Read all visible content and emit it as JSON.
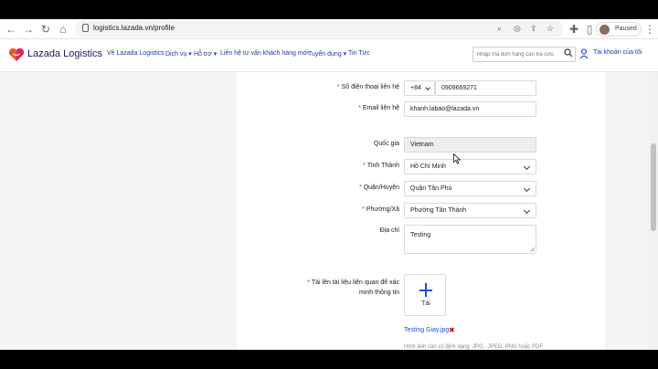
{
  "browser": {
    "url": "logistics.lazada.vn/profile",
    "profile_label": "Paused"
  },
  "header": {
    "logo_text": "Lazada Logistics",
    "menu": [
      {
        "label": "Về Lazada Logistics"
      },
      {
        "label": "Dịch vụ ▾"
      },
      {
        "label": "Hỗ trợ ▾"
      },
      {
        "label": "Liên hệ tư vấn khách hàng mới"
      },
      {
        "label": "Tuyển dụng ▾"
      },
      {
        "label": "Tin Tức"
      }
    ],
    "track_placeholder": "Nhập mã đơn hàng cần tra cứu",
    "account_label": "Tài khoản của tôi"
  },
  "form": {
    "phone": {
      "label": "Số điện thoại liên hệ",
      "country_code": "+84",
      "value": "0909669271"
    },
    "email": {
      "label": "Email liên hệ",
      "value": "khanh.labao@lazada.vn"
    },
    "country": {
      "label": "Quốc gia",
      "value": "Vietnam"
    },
    "province": {
      "label": "Tỉnh Thành",
      "value": "Hồ Chí Minh"
    },
    "district": {
      "label": "Quận/Huyện",
      "value": "Quận Tân Phú"
    },
    "ward": {
      "label": "Phường/Xã",
      "value": "Phường Tân Thành"
    },
    "address": {
      "label": "Địa chỉ",
      "value": "Testing"
    },
    "upload": {
      "label_line1": "Tải lên tài liệu liên quan để xác",
      "label_line2": "minh thông tin",
      "button_label": "Tải",
      "file_name": "Testing Giay.jpg",
      "remove_symbol": "✖",
      "hint": "Hình ảnh cần có định dạng .JPG, .JPEG, PNG hoặc PDF"
    }
  },
  "colors": {
    "link": "#1a3ba8",
    "required": "#e02020",
    "accent": "#1a4fd6"
  }
}
